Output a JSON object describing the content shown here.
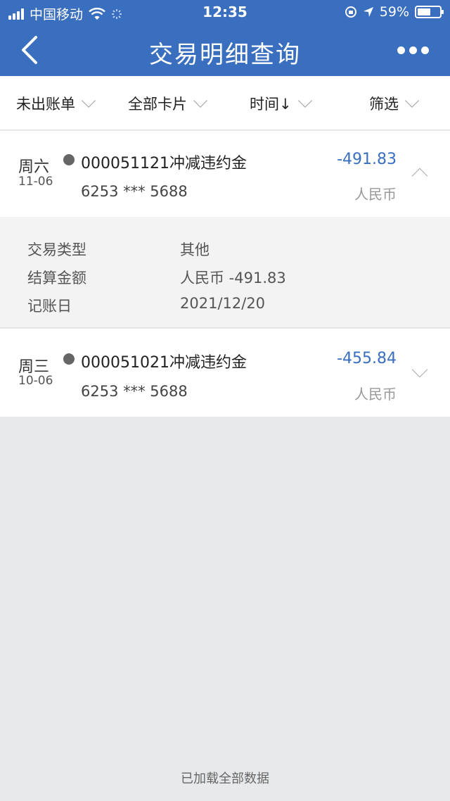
{
  "status_bar": {
    "carrier": "中国移动",
    "time": "12:35",
    "battery": "59%",
    "battery_level": 0.59
  },
  "nav": {
    "title": "交易明细查询"
  },
  "filters": [
    {
      "label": "未出账单"
    },
    {
      "label": "全部卡片"
    },
    {
      "label": "时间↓"
    },
    {
      "label": "筛选"
    }
  ],
  "transactions": [
    {
      "weekday": "周六",
      "date": "11-06",
      "description": "000051121冲减违约金",
      "card": "6253 *** 5688",
      "amount": "-491.83",
      "currency": "人民币",
      "expanded": true,
      "details": [
        {
          "key": "交易类型",
          "value": "其他"
        },
        {
          "key": "结算金额",
          "value": "人民币 -491.83"
        },
        {
          "key": "记账日",
          "value": "2021/12/20"
        }
      ]
    },
    {
      "weekday": "周三",
      "date": "10-06",
      "description": "000051021冲减违约金",
      "card": "6253 *** 5688",
      "amount": "-455.84",
      "currency": "人民币",
      "expanded": false
    }
  ],
  "footer": {
    "text": "已加载全部数据"
  },
  "colors": {
    "brand_blue": "#3a6fbf",
    "background": "#e8e9eb"
  }
}
